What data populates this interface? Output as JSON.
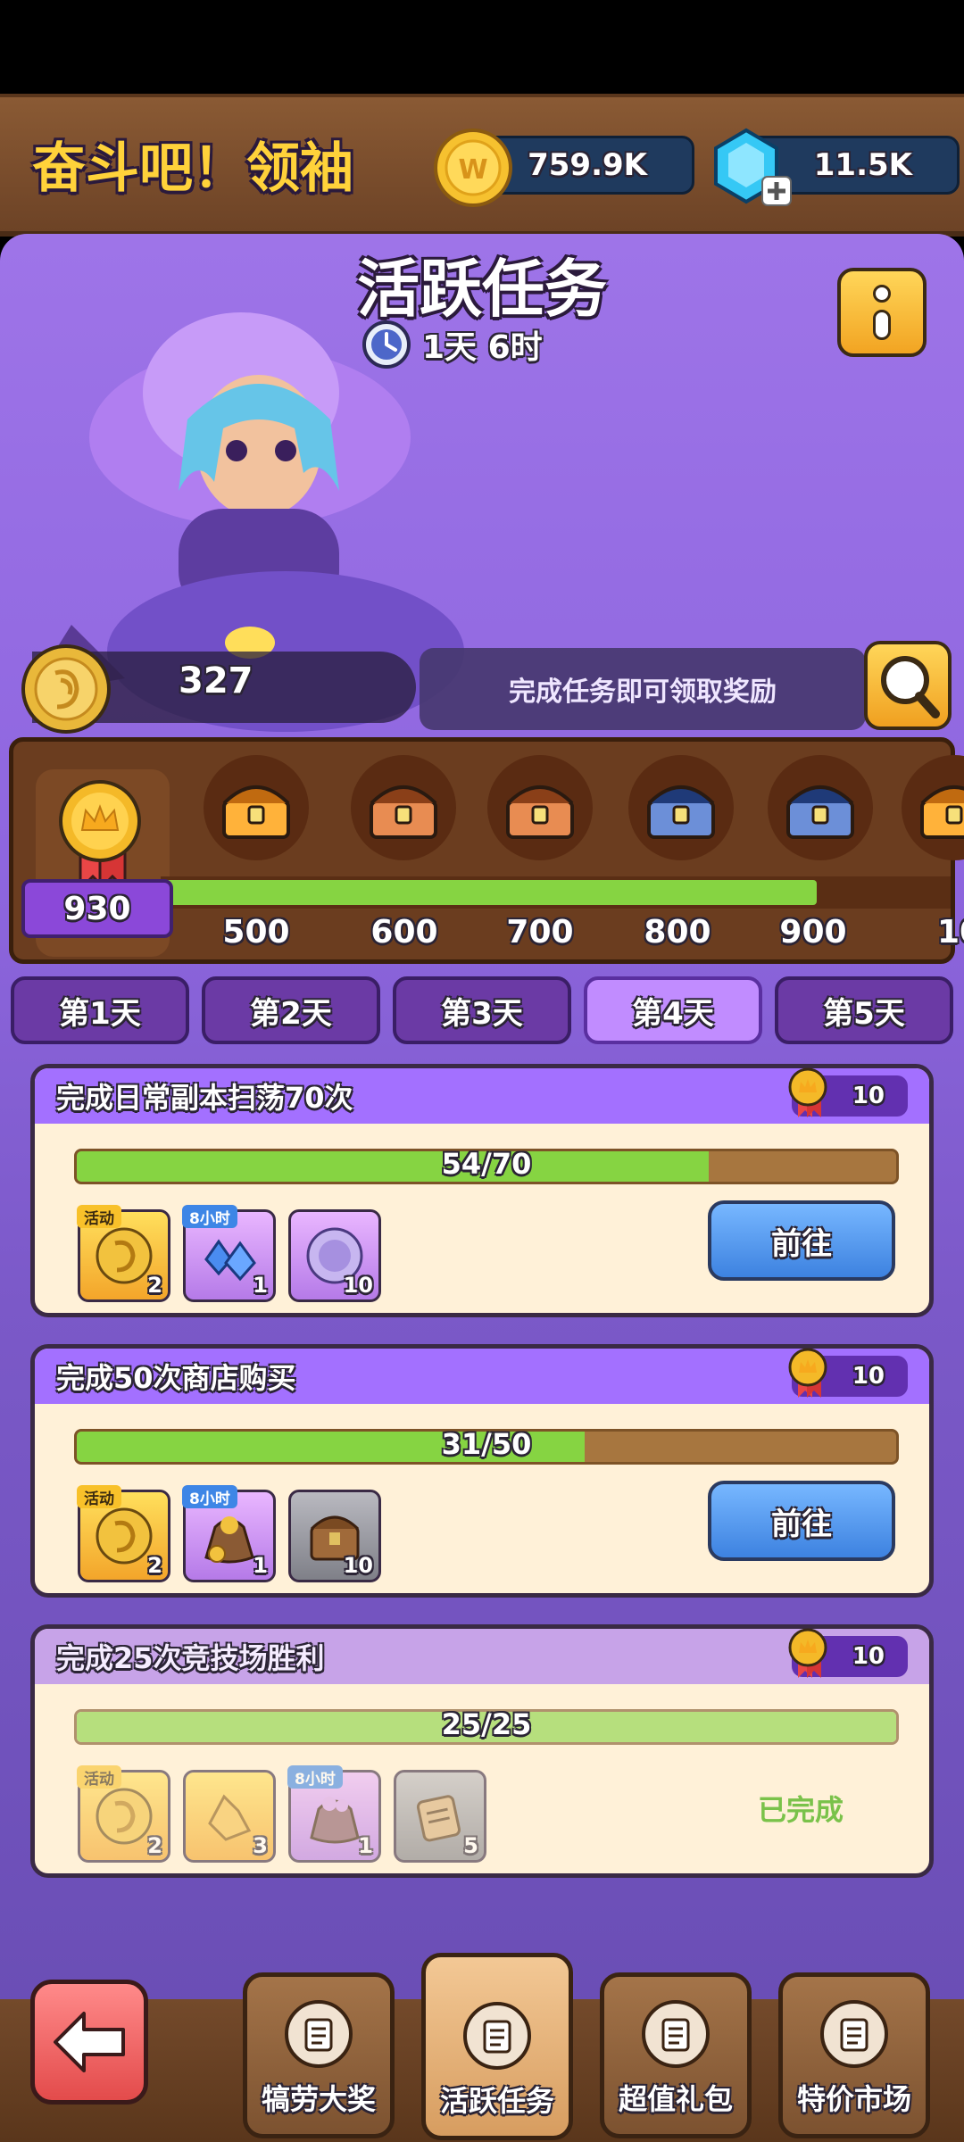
{
  "header": {
    "title": "奋斗吧！领袖",
    "coins": "759.9K",
    "gems": "11.5K"
  },
  "event": {
    "title": "活跃任务",
    "timer": "1天 6时",
    "points": "327",
    "hint": "完成任务即可领取奖励"
  },
  "progress": {
    "current_score": "930",
    "fill_fraction": 0.83,
    "milestones": [
      "500",
      "600",
      "700",
      "800",
      "900",
      "10"
    ]
  },
  "days": [
    {
      "label": "第1天",
      "active": false
    },
    {
      "label": "第2天",
      "active": false
    },
    {
      "label": "第3天",
      "active": false
    },
    {
      "label": "第4天",
      "active": true
    },
    {
      "label": "第5天",
      "active": false
    }
  ],
  "tasks": [
    {
      "title": "完成日常副本扫荡70次",
      "points": "10",
      "progress_text": "54/70",
      "progress_fraction": 0.771,
      "rewards": [
        {
          "tag": "活动",
          "count": "2",
          "icon": "event-coin-icon"
        },
        {
          "tag": "8小时",
          "count": "1",
          "icon": "blue-crystals-icon"
        },
        {
          "tag": "",
          "count": "10",
          "icon": "purple-coin-icon"
        }
      ],
      "action": "前往"
    },
    {
      "title": "完成50次商店购买",
      "points": "10",
      "progress_text": "31/50",
      "progress_fraction": 0.62,
      "rewards": [
        {
          "tag": "活动",
          "count": "2",
          "icon": "event-coin-icon"
        },
        {
          "tag": "8小时",
          "count": "1",
          "icon": "gold-bag-icon"
        },
        {
          "tag": "",
          "count": "10",
          "icon": "wooden-chest-icon"
        }
      ],
      "action": "前往"
    },
    {
      "title": "完成25次竞技场胜利",
      "points": "10",
      "progress_text": "25/25",
      "progress_fraction": 1.0,
      "rewards": [
        {
          "tag": "活动",
          "count": "2",
          "icon": "event-coin-icon"
        },
        {
          "tag": "",
          "count": "3",
          "icon": "gold-crystal-icon"
        },
        {
          "tag": "8小时",
          "count": "1",
          "icon": "purple-bag-icon"
        },
        {
          "tag": "",
          "count": "5",
          "icon": "scroll-icon"
        }
      ],
      "status": "已完成"
    }
  ],
  "nav": {
    "items": [
      "犒劳大奖",
      "活跃任务",
      "超值礼包",
      "特价市场"
    ]
  },
  "colors": {
    "panel": "#8e66df",
    "progress_green": "#86d442",
    "go_button": "#4a90e8",
    "done_text": "#7ac24a"
  }
}
